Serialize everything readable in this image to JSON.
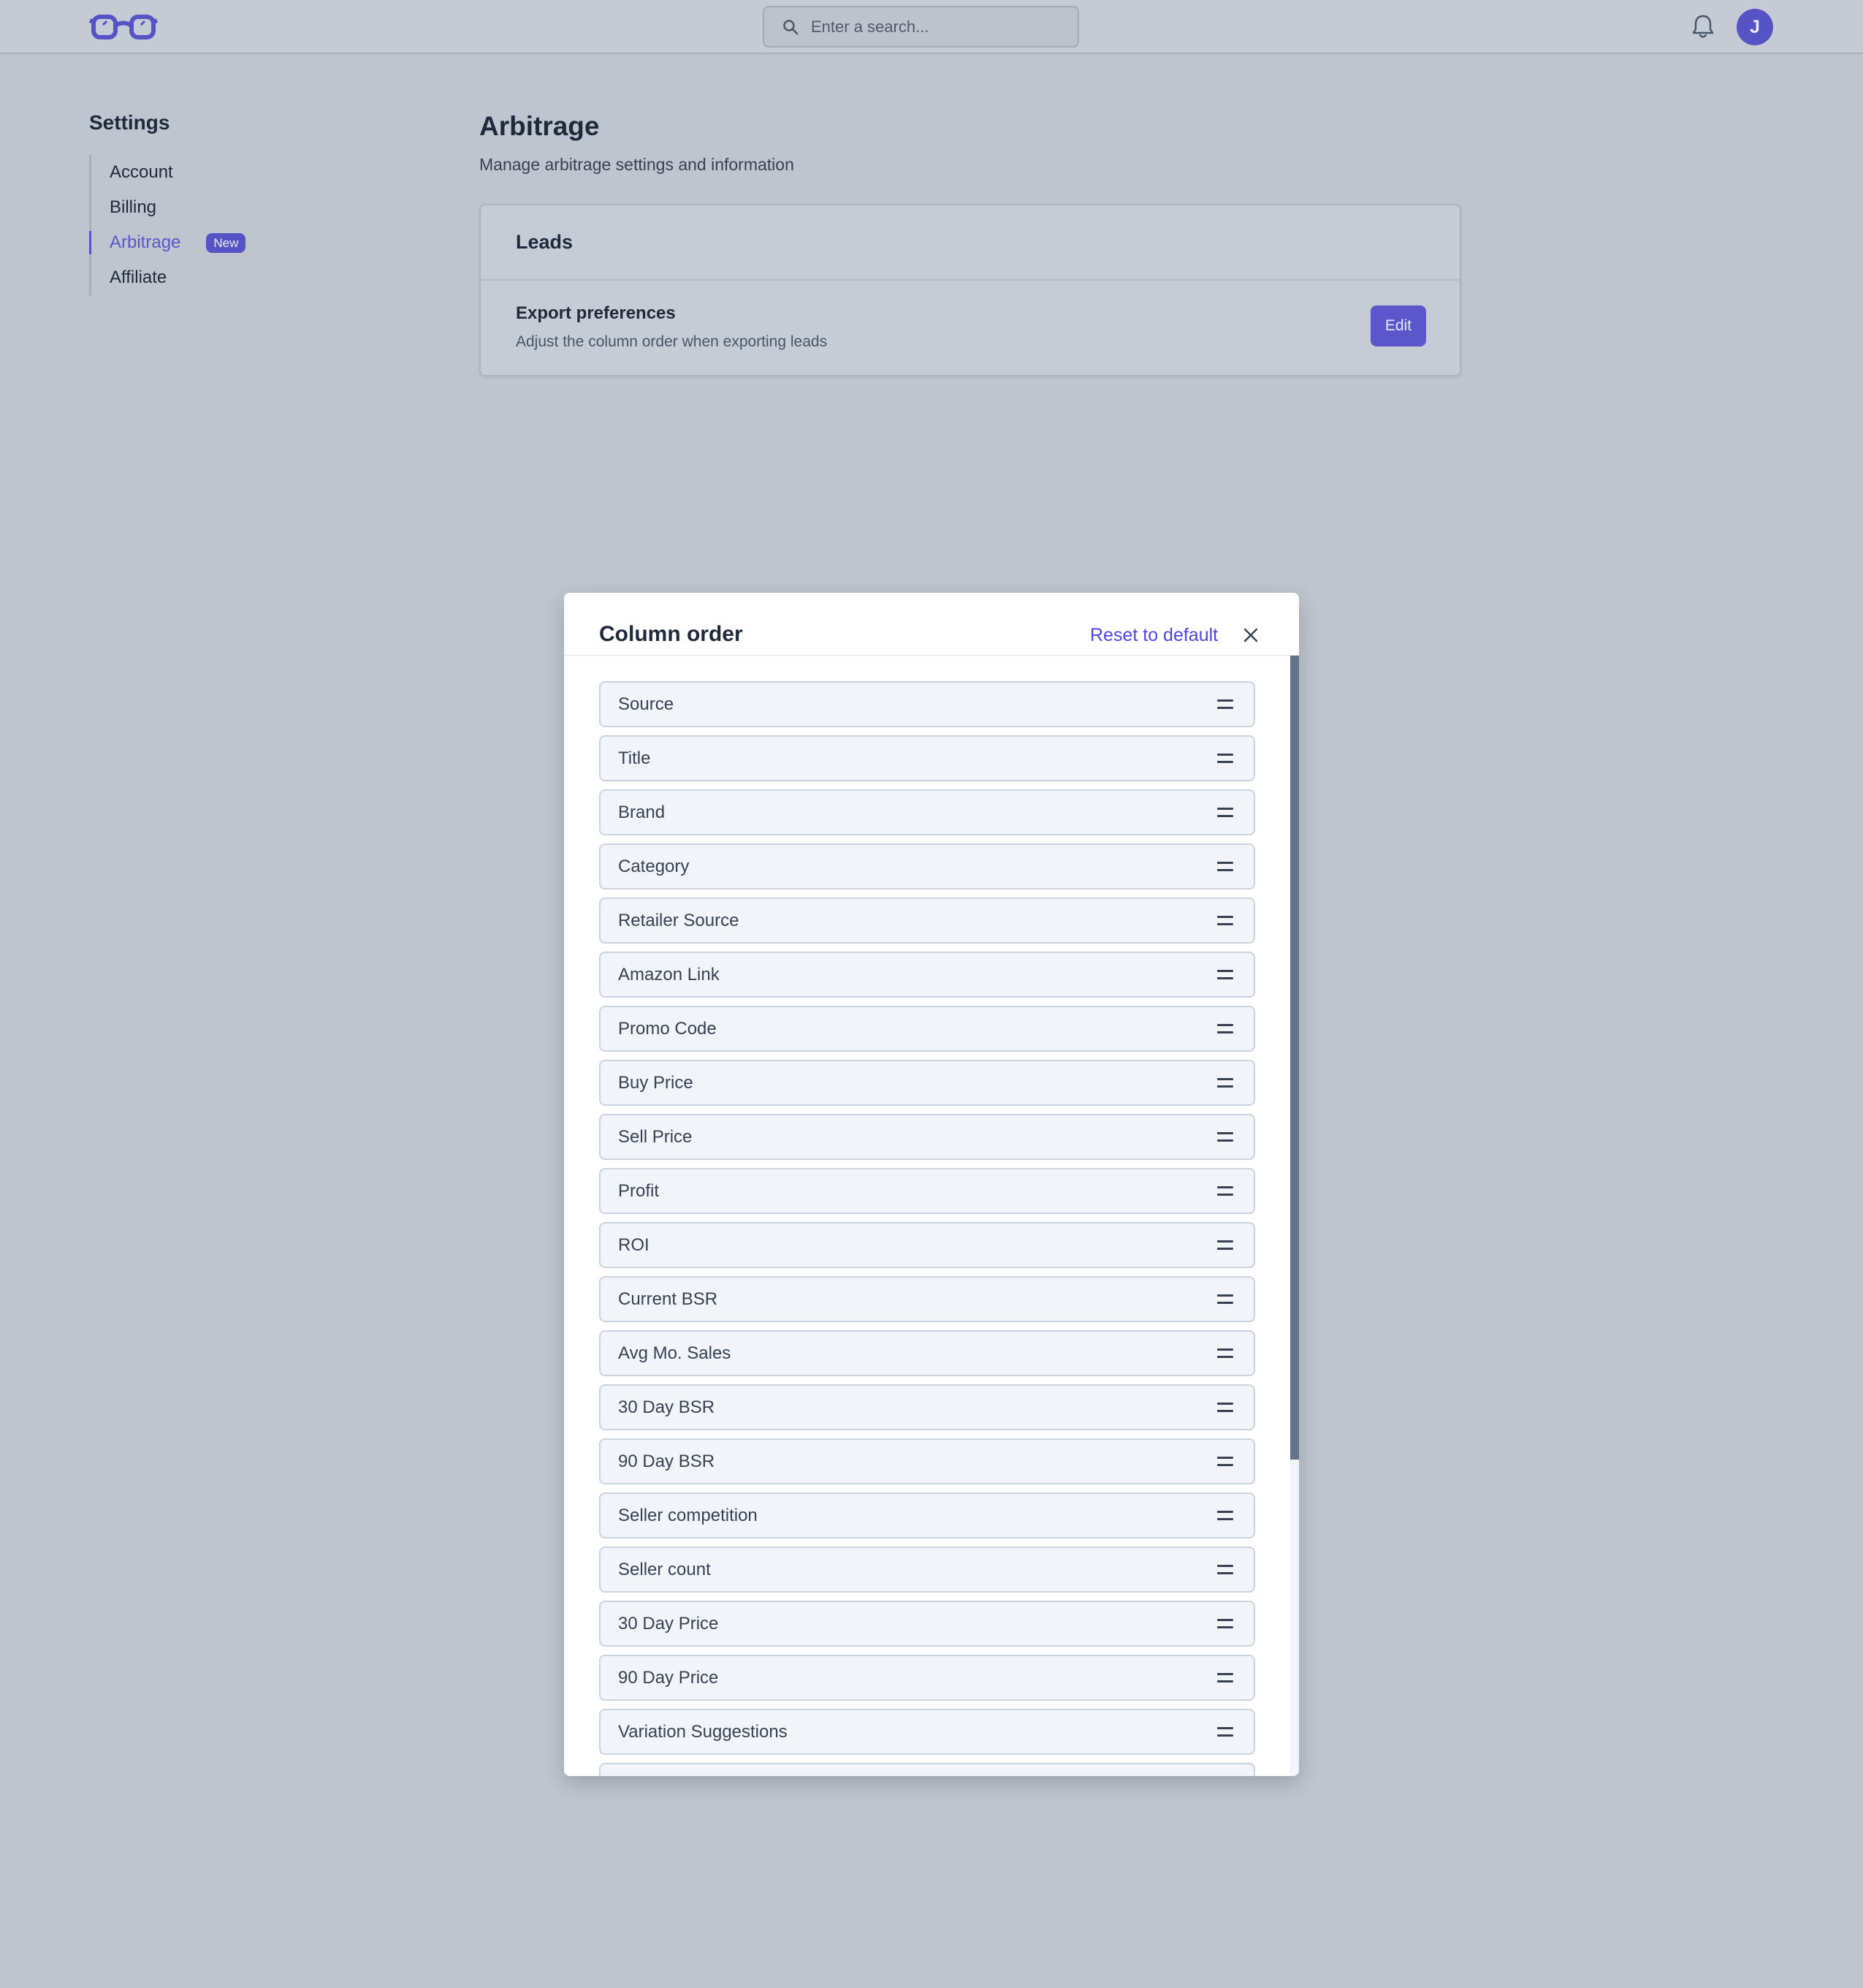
{
  "header": {
    "logo_icon": "glasses-logo-icon",
    "search_placeholder": "Enter a search...",
    "search_icon": "search-icon",
    "notification_icon": "bell-icon",
    "avatar_initial": "J"
  },
  "sidebar": {
    "title": "Settings",
    "items": [
      {
        "label": "Account",
        "active": false
      },
      {
        "label": "Billing",
        "active": false
      },
      {
        "label": "Arbitrage",
        "active": true,
        "badge": "New"
      },
      {
        "label": "Affiliate",
        "active": false
      }
    ]
  },
  "main": {
    "title": "Arbitrage",
    "subtitle": "Manage arbitrage settings and information",
    "card": {
      "title": "Leads",
      "row": {
        "title": "Export preferences",
        "description": "Adjust the column order when exporting leads",
        "button": "Edit"
      }
    }
  },
  "modal": {
    "title": "Column order",
    "reset_label": "Reset to default",
    "close_icon": "close-icon",
    "drag_icon": "drag-handle-icon",
    "columns": [
      "Source",
      "Title",
      "Brand",
      "Category",
      "Retailer Source",
      "Amazon Link",
      "Promo Code",
      "Buy Price",
      "Sell Price",
      "Profit",
      "ROI",
      "Current BSR",
      "Avg Mo. Sales",
      "30 Day BSR",
      "90 Day BSR",
      "Seller competition",
      "Seller count",
      "30 Day Price",
      "90 Day Price",
      "Variation Suggestions"
    ]
  },
  "colors": {
    "accent": "#5653c6",
    "link": "#4f46e5",
    "overlay_background": "#bec5cf",
    "modal_background": "#ffffff",
    "list_item_background": "#f1f5f9"
  }
}
